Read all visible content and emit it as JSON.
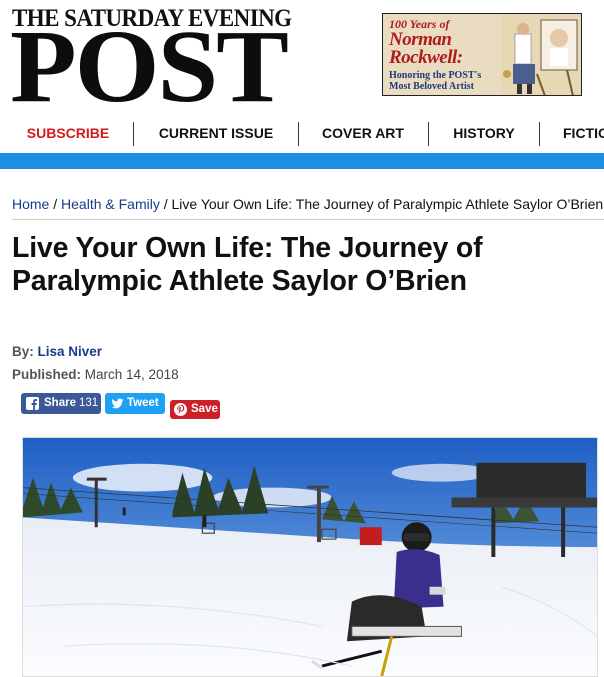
{
  "masthead": {
    "title_line1": "THE SATURDAY EVENING",
    "title_line2": "POST"
  },
  "promo": {
    "line1": "100 Years of",
    "line2": "Norman Rockwell:",
    "line3": "Honoring the POST's Most Beloved Artist"
  },
  "nav": {
    "items": [
      {
        "label": "SUBSCRIBE"
      },
      {
        "label": "CURRENT ISSUE"
      },
      {
        "label": "COVER ART"
      },
      {
        "label": "HISTORY"
      },
      {
        "label": "FICTION"
      }
    ]
  },
  "breadcrumb": {
    "home": "Home",
    "category": "Health & Family",
    "separator": "/",
    "current": "Live Your Own Life: The Journey of Paralympic Athlete Saylor O’Brien"
  },
  "article": {
    "title": "Live Your Own Life: The Journey of Paralympic Athlete Saylor O’Brien",
    "by_label": "By:",
    "author": "Lisa Niver",
    "published_label": "Published:",
    "published_date": "March 14, 2018"
  },
  "share": {
    "facebook_label": "Share",
    "facebook_count": "131",
    "twitter_label": "Tweet",
    "pinterest_label": "Save",
    "facebook_color": "#3b5998",
    "twitter_color": "#1da1f2",
    "pinterest_color": "#cb2027"
  },
  "colors": {
    "accent_blue": "#1d8fe0",
    "subscribe_red": "#d41a1a",
    "link_blue": "#173d8a"
  }
}
